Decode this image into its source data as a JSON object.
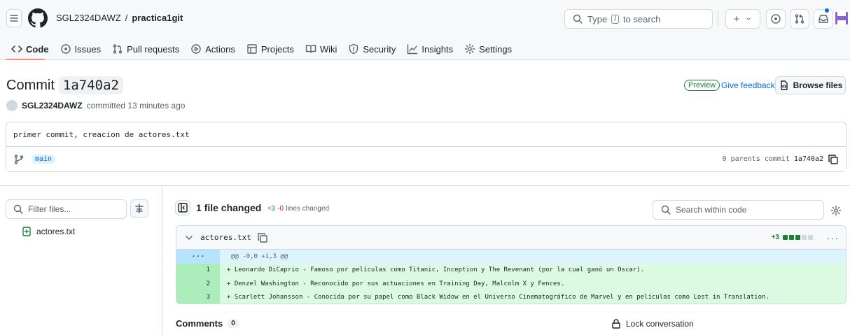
{
  "header": {
    "owner": "SGL2324DAWZ",
    "separator": "/",
    "repo": "practica1git",
    "search_placeholder_pre": "Type",
    "search_key": "/",
    "search_placeholder_post": "to search",
    "new_label": "+"
  },
  "tabs": [
    {
      "label": "Code",
      "icon": "code-icon"
    },
    {
      "label": "Issues",
      "icon": "issue-icon"
    },
    {
      "label": "Pull requests",
      "icon": "pull-request-icon"
    },
    {
      "label": "Actions",
      "icon": "play-icon"
    },
    {
      "label": "Projects",
      "icon": "table-icon"
    },
    {
      "label": "Wiki",
      "icon": "book-icon"
    },
    {
      "label": "Security",
      "icon": "shield-icon"
    },
    {
      "label": "Insights",
      "icon": "graph-icon"
    },
    {
      "label": "Settings",
      "icon": "gear-icon"
    }
  ],
  "commit": {
    "title_prefix": "Commit",
    "sha": "1a740a2",
    "author": "SGL2324DAWZ",
    "action": "committed 13 minutes ago",
    "preview_label": "Preview",
    "feedback_label": "Give feedback",
    "browse_label": "Browse files",
    "message": "primer commit, creacion de actores.txt",
    "branch": "main",
    "parents": "0 parents",
    "commit_label": "commit",
    "commit_sha": "1a740a2"
  },
  "files": {
    "filter_placeholder": "Filter files...",
    "items": [
      "actores.txt"
    ]
  },
  "summary": {
    "changed": "1 file changed",
    "additions": "+3",
    "deletions": "-0",
    "lines_label": "lines changed",
    "search_placeholder": "Search within code"
  },
  "diff": {
    "filename": "actores.txt",
    "stat": "+3",
    "hunk_marker": "···",
    "hunk": "@@ -0,0 +1,3 @@",
    "lines": [
      {
        "num": "1",
        "text": "+ Leonardo DiCaprio - Famoso por películas como Titanic, Inception y The Revenant (por la cual ganó un Oscar)."
      },
      {
        "num": "2",
        "text": "+ Denzel Washington - Reconocido por sus actuaciones en Training Day, Malcolm X y Fences."
      },
      {
        "num": "3",
        "text": "+ Scarlett Johansson - Conocida por su papel como Black Widow en el Universo Cinematográfico de Marvel y en películas como Lost in Translation."
      }
    ]
  },
  "comments": {
    "label": "Comments",
    "count": "0",
    "lock_label": "Lock conversation"
  },
  "colors": {
    "accent": "#0969da",
    "added_bg": "#dafbe1",
    "added_num_bg": "#aceebb",
    "hunk_bg": "#ddf4ff",
    "tab_underline": "#fd8c73"
  }
}
